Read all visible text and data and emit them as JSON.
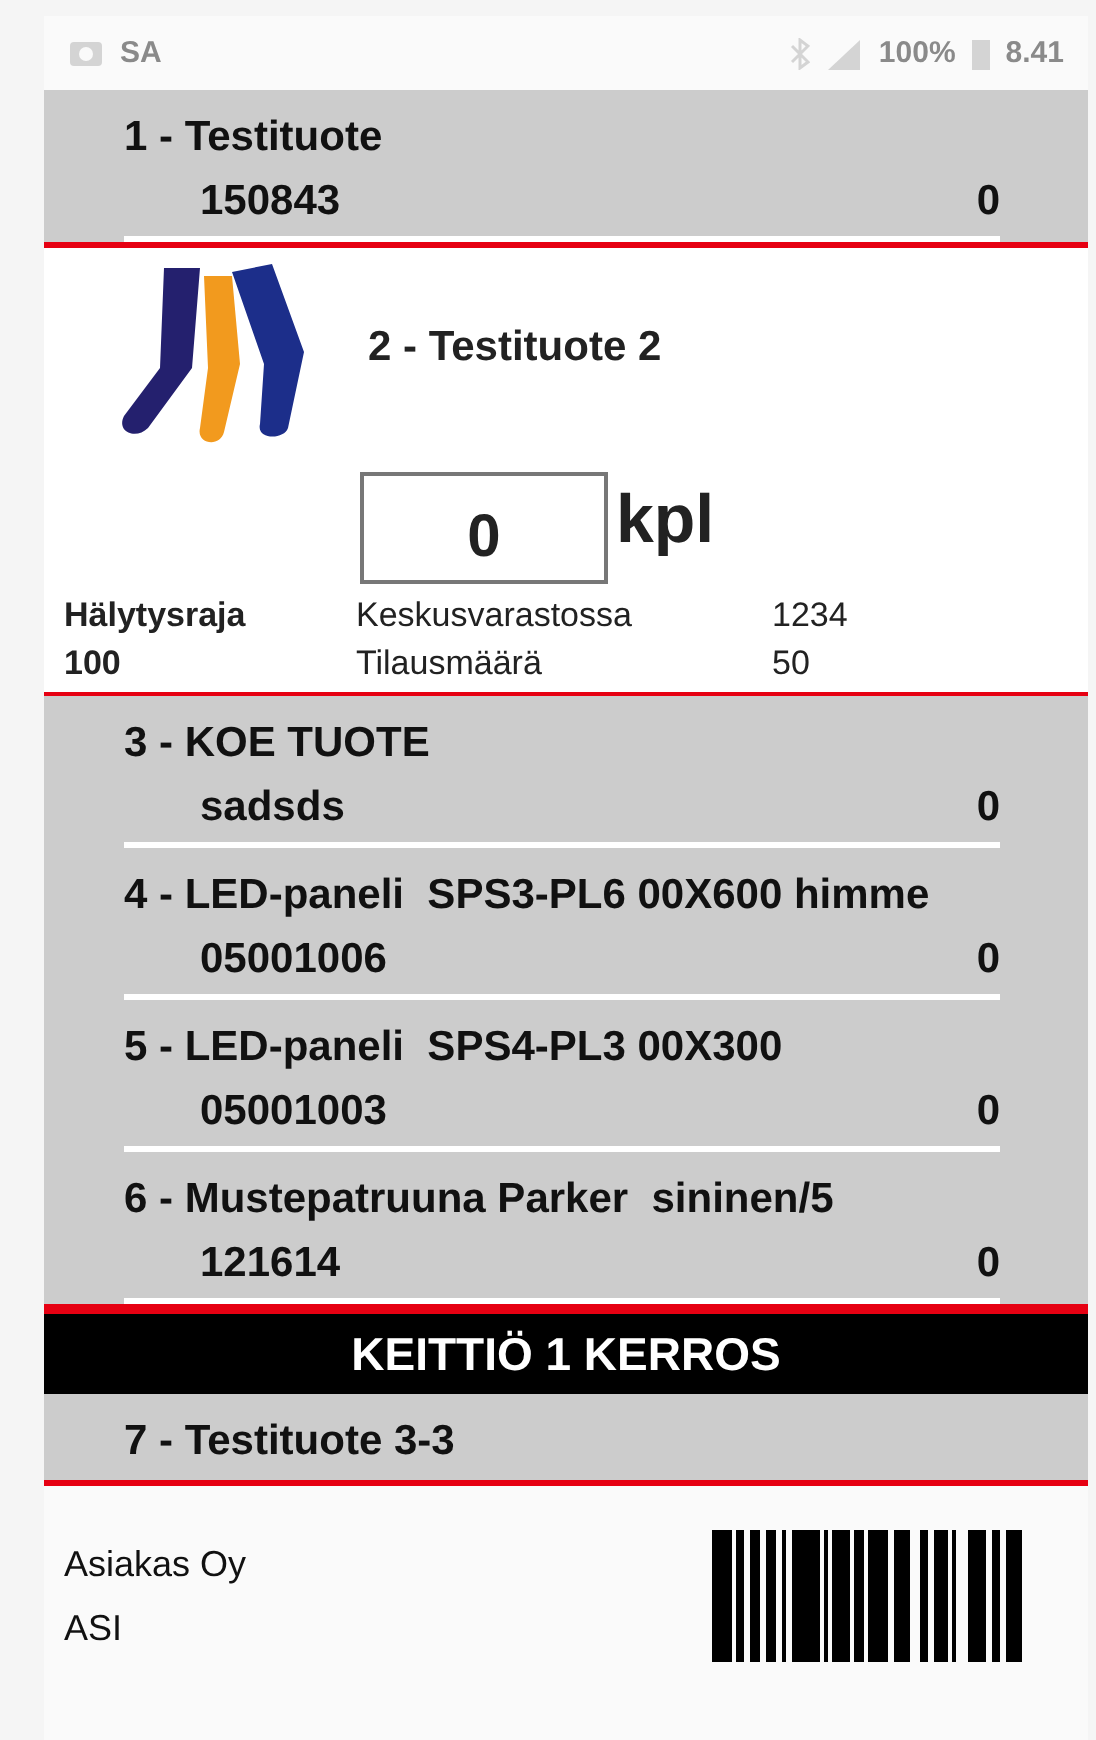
{
  "status_bar": {
    "carrier": "SA",
    "battery": "100%",
    "time": "8.41"
  },
  "lines": [
    {
      "kind": "product",
      "label": "1 - Testituote",
      "code": "150843",
      "quantity": "0"
    },
    {
      "kind": "expanded",
      "label": "2 - Testituote 2",
      "amount": "0",
      "unit": "kpl",
      "alert_label": "Hälytysraja",
      "alert_value": "100",
      "stock_label": "Keskusvarastossa",
      "stock_value": "1234",
      "order_label": "Tilausmäärä",
      "order_value": "50"
    },
    {
      "kind": "product",
      "label": "3 - KOE TUOTE",
      "code": "sadsds",
      "quantity": "0"
    },
    {
      "kind": "product",
      "label": "4 - LED-paneli  SPS3-PL6 00X600 himme",
      "code": "05001006",
      "quantity": "0"
    },
    {
      "kind": "product",
      "label": "5 - LED-paneli  SPS4-PL3 00X300",
      "code": "05001003",
      "quantity": "0"
    },
    {
      "kind": "product",
      "label": "6 - Mustepatruuna Parker  sininen/5",
      "code": "121614",
      "quantity": "0"
    },
    {
      "kind": "section",
      "title": "KEITTIÖ 1 KERROS"
    },
    {
      "kind": "product",
      "label": "7 - Testituote 3-3"
    }
  ],
  "footer": {
    "customer": "Asiakas Oy",
    "customer_code": "ASI"
  }
}
